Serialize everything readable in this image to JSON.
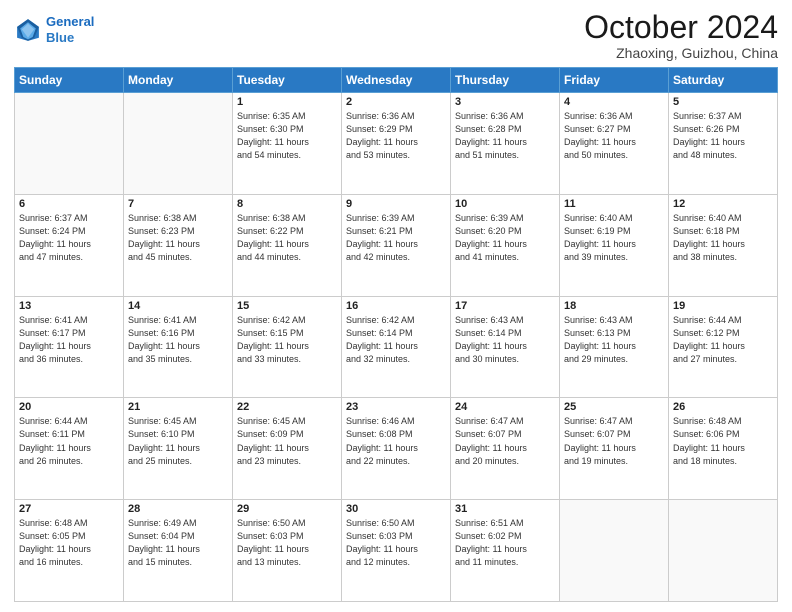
{
  "header": {
    "logo_line1": "General",
    "logo_line2": "Blue",
    "title": "October 2024",
    "subtitle": "Zhaoxing, Guizhou, China"
  },
  "weekdays": [
    "Sunday",
    "Monday",
    "Tuesday",
    "Wednesday",
    "Thursday",
    "Friday",
    "Saturday"
  ],
  "weeks": [
    [
      {
        "day": "",
        "info": ""
      },
      {
        "day": "",
        "info": ""
      },
      {
        "day": "1",
        "info": "Sunrise: 6:35 AM\nSunset: 6:30 PM\nDaylight: 11 hours\nand 54 minutes."
      },
      {
        "day": "2",
        "info": "Sunrise: 6:36 AM\nSunset: 6:29 PM\nDaylight: 11 hours\nand 53 minutes."
      },
      {
        "day": "3",
        "info": "Sunrise: 6:36 AM\nSunset: 6:28 PM\nDaylight: 11 hours\nand 51 minutes."
      },
      {
        "day": "4",
        "info": "Sunrise: 6:36 AM\nSunset: 6:27 PM\nDaylight: 11 hours\nand 50 minutes."
      },
      {
        "day": "5",
        "info": "Sunrise: 6:37 AM\nSunset: 6:26 PM\nDaylight: 11 hours\nand 48 minutes."
      }
    ],
    [
      {
        "day": "6",
        "info": "Sunrise: 6:37 AM\nSunset: 6:24 PM\nDaylight: 11 hours\nand 47 minutes."
      },
      {
        "day": "7",
        "info": "Sunrise: 6:38 AM\nSunset: 6:23 PM\nDaylight: 11 hours\nand 45 minutes."
      },
      {
        "day": "8",
        "info": "Sunrise: 6:38 AM\nSunset: 6:22 PM\nDaylight: 11 hours\nand 44 minutes."
      },
      {
        "day": "9",
        "info": "Sunrise: 6:39 AM\nSunset: 6:21 PM\nDaylight: 11 hours\nand 42 minutes."
      },
      {
        "day": "10",
        "info": "Sunrise: 6:39 AM\nSunset: 6:20 PM\nDaylight: 11 hours\nand 41 minutes."
      },
      {
        "day": "11",
        "info": "Sunrise: 6:40 AM\nSunset: 6:19 PM\nDaylight: 11 hours\nand 39 minutes."
      },
      {
        "day": "12",
        "info": "Sunrise: 6:40 AM\nSunset: 6:18 PM\nDaylight: 11 hours\nand 38 minutes."
      }
    ],
    [
      {
        "day": "13",
        "info": "Sunrise: 6:41 AM\nSunset: 6:17 PM\nDaylight: 11 hours\nand 36 minutes."
      },
      {
        "day": "14",
        "info": "Sunrise: 6:41 AM\nSunset: 6:16 PM\nDaylight: 11 hours\nand 35 minutes."
      },
      {
        "day": "15",
        "info": "Sunrise: 6:42 AM\nSunset: 6:15 PM\nDaylight: 11 hours\nand 33 minutes."
      },
      {
        "day": "16",
        "info": "Sunrise: 6:42 AM\nSunset: 6:14 PM\nDaylight: 11 hours\nand 32 minutes."
      },
      {
        "day": "17",
        "info": "Sunrise: 6:43 AM\nSunset: 6:14 PM\nDaylight: 11 hours\nand 30 minutes."
      },
      {
        "day": "18",
        "info": "Sunrise: 6:43 AM\nSunset: 6:13 PM\nDaylight: 11 hours\nand 29 minutes."
      },
      {
        "day": "19",
        "info": "Sunrise: 6:44 AM\nSunset: 6:12 PM\nDaylight: 11 hours\nand 27 minutes."
      }
    ],
    [
      {
        "day": "20",
        "info": "Sunrise: 6:44 AM\nSunset: 6:11 PM\nDaylight: 11 hours\nand 26 minutes."
      },
      {
        "day": "21",
        "info": "Sunrise: 6:45 AM\nSunset: 6:10 PM\nDaylight: 11 hours\nand 25 minutes."
      },
      {
        "day": "22",
        "info": "Sunrise: 6:45 AM\nSunset: 6:09 PM\nDaylight: 11 hours\nand 23 minutes."
      },
      {
        "day": "23",
        "info": "Sunrise: 6:46 AM\nSunset: 6:08 PM\nDaylight: 11 hours\nand 22 minutes."
      },
      {
        "day": "24",
        "info": "Sunrise: 6:47 AM\nSunset: 6:07 PM\nDaylight: 11 hours\nand 20 minutes."
      },
      {
        "day": "25",
        "info": "Sunrise: 6:47 AM\nSunset: 6:07 PM\nDaylight: 11 hours\nand 19 minutes."
      },
      {
        "day": "26",
        "info": "Sunrise: 6:48 AM\nSunset: 6:06 PM\nDaylight: 11 hours\nand 18 minutes."
      }
    ],
    [
      {
        "day": "27",
        "info": "Sunrise: 6:48 AM\nSunset: 6:05 PM\nDaylight: 11 hours\nand 16 minutes."
      },
      {
        "day": "28",
        "info": "Sunrise: 6:49 AM\nSunset: 6:04 PM\nDaylight: 11 hours\nand 15 minutes."
      },
      {
        "day": "29",
        "info": "Sunrise: 6:50 AM\nSunset: 6:03 PM\nDaylight: 11 hours\nand 13 minutes."
      },
      {
        "day": "30",
        "info": "Sunrise: 6:50 AM\nSunset: 6:03 PM\nDaylight: 11 hours\nand 12 minutes."
      },
      {
        "day": "31",
        "info": "Sunrise: 6:51 AM\nSunset: 6:02 PM\nDaylight: 11 hours\nand 11 minutes."
      },
      {
        "day": "",
        "info": ""
      },
      {
        "day": "",
        "info": ""
      }
    ]
  ]
}
